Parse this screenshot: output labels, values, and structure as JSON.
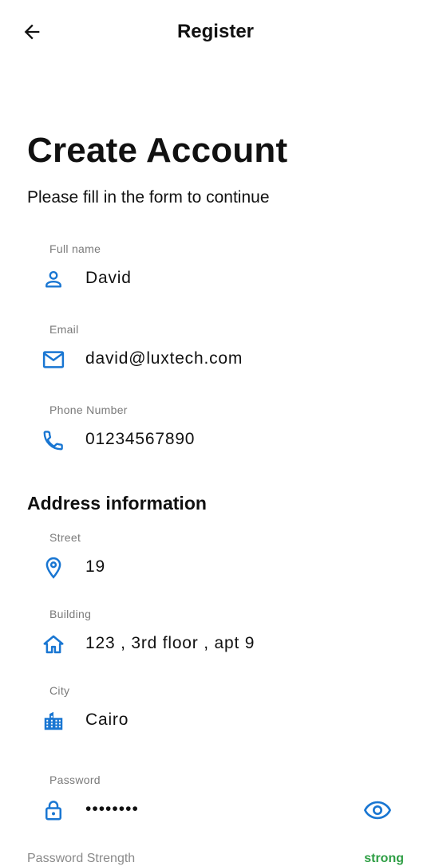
{
  "appbar": {
    "title": "Register",
    "back_icon": "arrow-left-icon"
  },
  "header": {
    "title": "Create Account",
    "subtitle": "Please fill in the form to continue"
  },
  "fields": {
    "full_name": {
      "label": "Full name",
      "value": "David",
      "icon": "person-icon"
    },
    "email": {
      "label": "Email",
      "value": "david@luxtech.com",
      "icon": "mail-icon"
    },
    "phone": {
      "label": "Phone Number",
      "value": "01234567890",
      "icon": "phone-icon"
    }
  },
  "address": {
    "section_title": "Address information",
    "street": {
      "label": "Street",
      "value": "19",
      "icon": "location-pin-icon"
    },
    "building": {
      "label": "Building",
      "value": "123 , 3rd floor , apt 9",
      "icon": "home-icon"
    },
    "city": {
      "label": "City",
      "value": "Cairo",
      "icon": "city-icon"
    }
  },
  "password": {
    "label": "Password",
    "value": "••••••••",
    "icon": "lock-icon",
    "toggle_icon": "eye-icon"
  },
  "strength": {
    "label": "Password Strength",
    "value": "strong"
  },
  "colors": {
    "accent": "#1976d2",
    "strength_good": "#2e9e44",
    "label_gray": "#7a7a7a"
  }
}
